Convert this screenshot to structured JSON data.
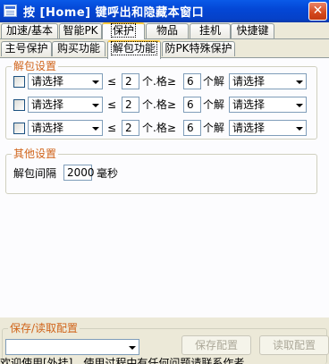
{
  "window": {
    "title": "按 [Home] 键呼出和隐藏本窗口",
    "close_glyph": "✕"
  },
  "tabs_row1": [
    {
      "label": "加速/基本"
    },
    {
      "label": "智能PK"
    },
    {
      "label": "保护",
      "active": true
    },
    {
      "label": "物品"
    },
    {
      "label": "挂机"
    },
    {
      "label": "快捷键"
    }
  ],
  "tabs_row2": [
    {
      "label": "主号保护"
    },
    {
      "label": "购买功能"
    },
    {
      "label": "解包功能",
      "active": true
    },
    {
      "label": "防PK特殊保护"
    }
  ],
  "unpack_group": {
    "title": "解包设置",
    "rows": [
      {
        "checked": false,
        "item": "请选择",
        "lte_symbol": "≤",
        "min": "2",
        "unit_ge": "个.格≥",
        "max": "6",
        "unit_unpack": "个解",
        "target": "请选择"
      },
      {
        "checked": false,
        "item": "请选择",
        "lte_symbol": "≤",
        "min": "2",
        "unit_ge": "个.格≥",
        "max": "6",
        "unit_unpack": "个解",
        "target": "请选择"
      },
      {
        "checked": false,
        "item": "请选择",
        "lte_symbol": "≤",
        "min": "2",
        "unit_ge": "个.格≥",
        "max": "6",
        "unit_unpack": "个解",
        "target": "请选择"
      }
    ]
  },
  "other_group": {
    "title": "其他设置",
    "interval_label": "解包间隔",
    "interval_value": "2000",
    "interval_unit": "毫秒"
  },
  "save_group": {
    "title": "保存/读取配置",
    "config_value": "",
    "save_button": "保存配置",
    "load_button": "读取配置"
  },
  "status_text": "欢迎使用[外挂]，使用过程中有任何问题请联系作者"
}
